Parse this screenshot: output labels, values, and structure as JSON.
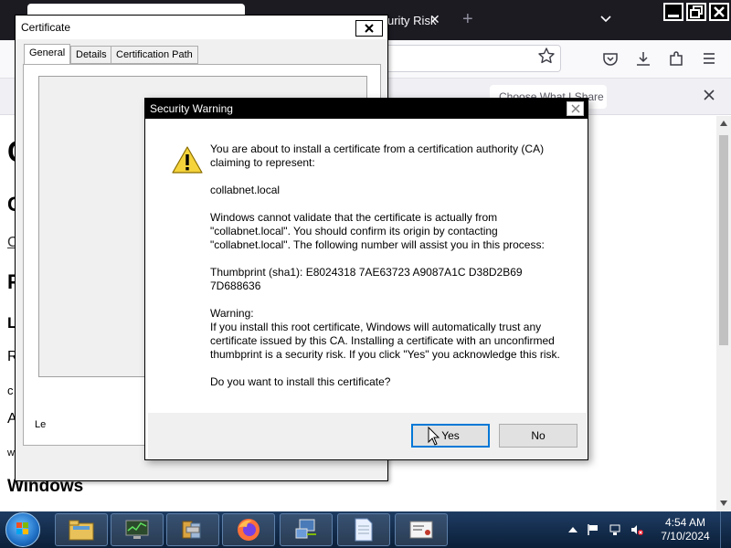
{
  "browser": {
    "tab_text": "urity Risk",
    "tab_close": "✕",
    "new_tab": "+",
    "notification": {
      "button_label": "Choose What I Share",
      "close": "✕"
    }
  },
  "page_behind": {
    "letters": [
      "C",
      "C",
      "C",
      "P",
      "L",
      "R",
      "c",
      "A",
      "w"
    ],
    "heading": "Windows"
  },
  "certificate_window": {
    "title": "Certificate",
    "tabs": [
      "General",
      "Details",
      "Certification Path"
    ],
    "learn_link": "Le"
  },
  "security_warning": {
    "title": "Security Warning",
    "paragraphs": [
      "You are about to install a certificate from a certification authority (CA) claiming to represent:",
      "collabnet.local",
      "Windows cannot validate that the certificate is actually from \"collabnet.local\". You should confirm its origin by contacting \"collabnet.local\". The following number will assist you in this process:",
      "Thumbprint (sha1): E8024318 7AE63723 A9087A1C D38D2B69 7D688636",
      "Warning:\nIf you install this root certificate, Windows will automatically trust any certificate issued by this CA. Installing a certificate with an unconfirmed thumbprint is a security risk. If you click \"Yes\" you acknowledge this risk.",
      "Do you want to install this certificate?"
    ],
    "buttons": {
      "yes": "Yes",
      "no": "No"
    }
  },
  "taskbar": {
    "time": "4:54 AM",
    "date": "7/10/2024"
  },
  "colors": {
    "titlebar_dark": "#1c1b22",
    "dialog_title": "#000000",
    "taskbar": "#1e3c63",
    "default_button_border": "#0078d7"
  }
}
